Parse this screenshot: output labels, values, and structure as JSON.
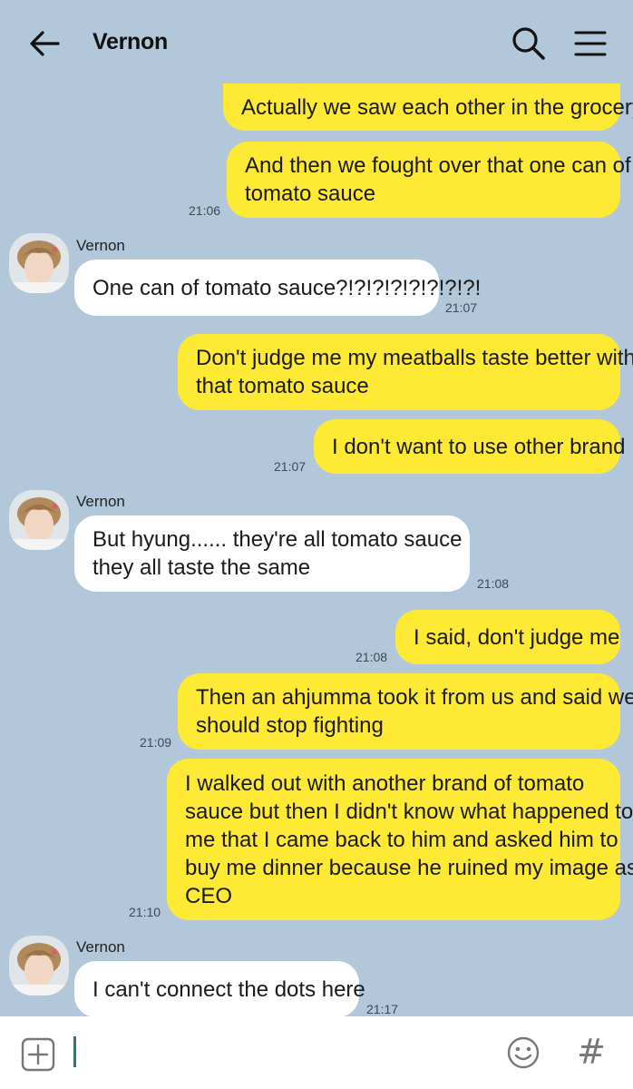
{
  "header": {
    "back_icon": "arrow-left-icon",
    "title": "Vernon",
    "search_icon": "search-icon",
    "menu_icon": "hamburger-menu-icon"
  },
  "colors": {
    "background": "#b2c7da",
    "my_bubble": "#fee934",
    "their_bubble": "#ffffff",
    "caret": "#1f7f80"
  },
  "messages": [
    {
      "from": "me",
      "lines": [
        "Actually we saw each other in the grocery"
      ],
      "time": ""
    },
    {
      "from": "me",
      "lines": [
        "And then we fought over that one can of",
        "tomato sauce"
      ],
      "time": "21:06"
    },
    {
      "from": "them",
      "sender": "Vernon",
      "lines": [
        "One can of tomato sauce?!?!?!?!?!?!?!?!"
      ],
      "time": "21:07"
    },
    {
      "from": "me",
      "lines": [
        "Don't judge me my meatballs taste better with",
        "that tomato sauce"
      ],
      "time": ""
    },
    {
      "from": "me",
      "lines": [
        "I don't want to use other brand"
      ],
      "time": "21:07"
    },
    {
      "from": "them",
      "sender": "Vernon",
      "lines": [
        "But hyung...... they're all tomato sauce",
        "they all taste the same"
      ],
      "time": "21:08"
    },
    {
      "from": "me",
      "lines": [
        "I said, don't judge me"
      ],
      "time": "21:08"
    },
    {
      "from": "me",
      "lines": [
        "Then an ahjumma took it from us and said we",
        "should stop fighting"
      ],
      "time": "21:09"
    },
    {
      "from": "me",
      "lines": [
        "I walked out with another brand of tomato",
        "sauce but then I didn't know what happened to",
        "me that I came back to him and asked him to",
        "buy me dinner because he ruined my image as",
        "CEO"
      ],
      "time": "21:10"
    },
    {
      "from": "them",
      "sender": "Vernon",
      "lines": [
        "I can't connect the dots here"
      ],
      "time": "21:17"
    }
  ],
  "input": {
    "plus_icon": "add-attachment-icon",
    "value": "",
    "emoji_icon": "emoji-icon",
    "hash_icon": "hashtag-icon",
    "hash_glyph": "#"
  }
}
